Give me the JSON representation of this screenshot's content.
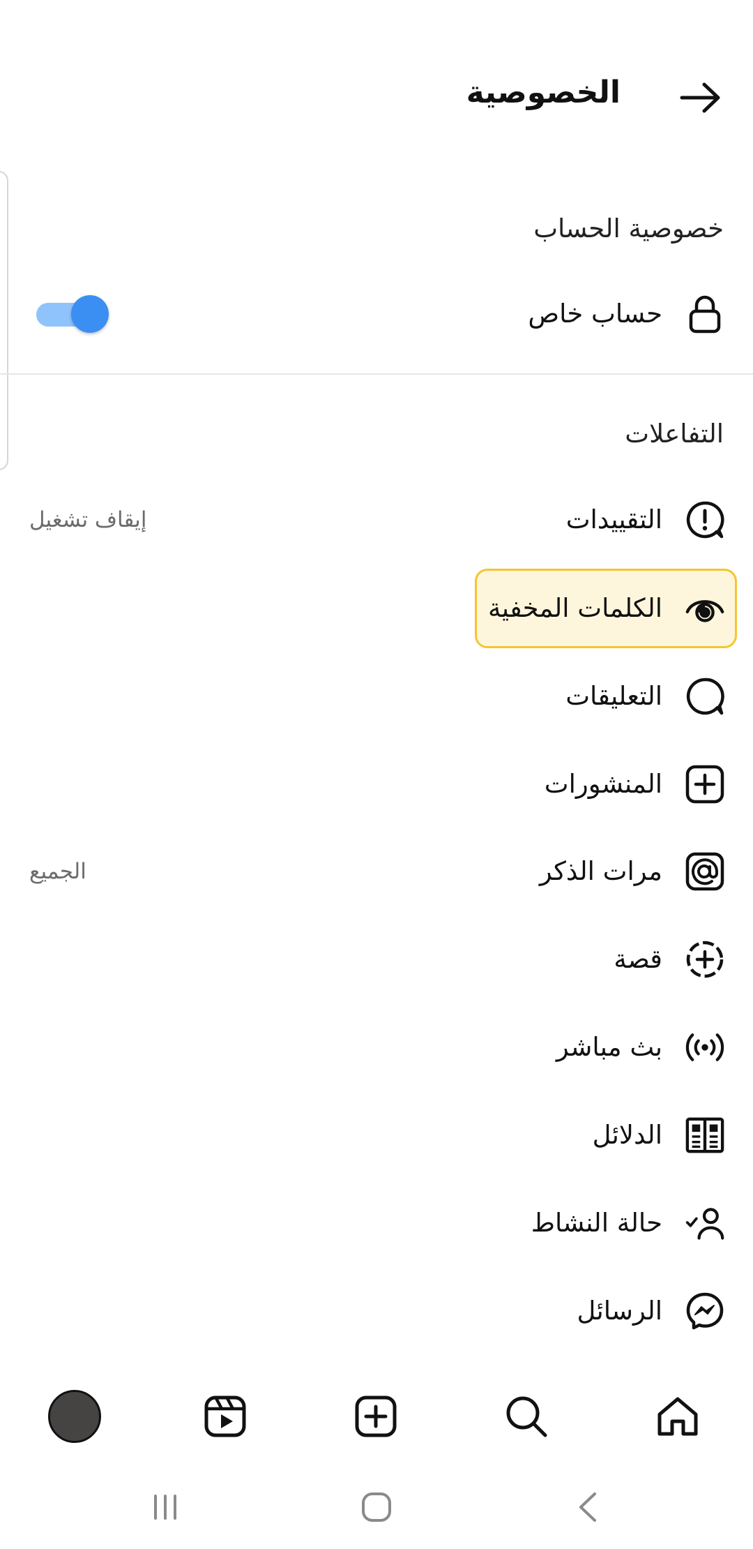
{
  "header": {
    "title": "الخصوصية"
  },
  "account_privacy": {
    "section_title": "خصوصية الحساب",
    "private_account": {
      "label": "حساب خاص",
      "enabled": true,
      "icon": "lock-icon"
    }
  },
  "interactions": {
    "section_title": "التفاعلات",
    "items": [
      {
        "label": "التقييدات",
        "value": "إيقاف تشغيل",
        "icon": "alert-icon"
      },
      {
        "label": "الكلمات المخفية",
        "value": "",
        "icon": "eye-icon",
        "highlighted": true
      },
      {
        "label": "التعليقات",
        "value": "",
        "icon": "comment-icon"
      },
      {
        "label": "المنشورات",
        "value": "",
        "icon": "post-plus-icon"
      },
      {
        "label": "مرات الذكر",
        "value": "الجميع",
        "icon": "mention-icon"
      },
      {
        "label": "قصة",
        "value": "",
        "icon": "story-plus-icon"
      },
      {
        "label": "بث مباشر",
        "value": "",
        "icon": "live-icon"
      },
      {
        "label": "الدلائل",
        "value": "",
        "icon": "guides-icon"
      },
      {
        "label": "حالة النشاط",
        "value": "",
        "icon": "activity-status-icon"
      },
      {
        "label": "الرسائل",
        "value": "",
        "icon": "messenger-icon"
      }
    ]
  },
  "bottom_nav": [
    "home-icon",
    "search-icon",
    "create-icon",
    "reels-icon",
    "profile-avatar"
  ],
  "system_nav": [
    "recents-icon",
    "home-button-icon",
    "back-chevron-icon"
  ],
  "colors": {
    "toggle_track": "#8fc3fb",
    "toggle_thumb": "#3b8ff3",
    "highlight_border": "#f5c531",
    "highlight_fill": "#fdf6dc",
    "icon_stroke": "#111111",
    "secondary_text": "#6b6b6b"
  }
}
